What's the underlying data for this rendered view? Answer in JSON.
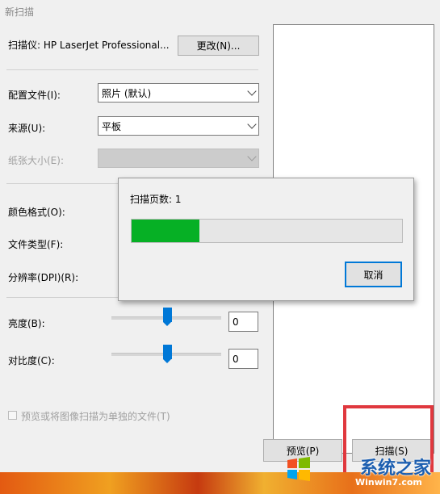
{
  "window": {
    "title": "新扫描"
  },
  "scanner": {
    "label": "扫描仪: HP LaserJet Professional...",
    "change_button": "更改(N)..."
  },
  "profile": {
    "label": "配置文件(I):",
    "value": "照片 (默认)"
  },
  "source": {
    "label": "来源(U):",
    "value": "平板"
  },
  "paper_size": {
    "label": "纸张大小(E):",
    "value": ""
  },
  "color_format": {
    "label": "颜色格式(O):"
  },
  "file_type": {
    "label": "文件类型(F):"
  },
  "resolution": {
    "label": "分辨率(DPI)(R):"
  },
  "brightness": {
    "label": "亮度(B):",
    "value": "0",
    "slider_fraction": 0.5
  },
  "contrast": {
    "label": "对比度(C):",
    "value": "0",
    "slider_fraction": 0.5
  },
  "separate_files": {
    "label": "预览或将图像扫描为单独的文件(T)",
    "checked": false
  },
  "buttons": {
    "preview": "预览(P)",
    "scan": "扫描(S)"
  },
  "progress_dialog": {
    "pages_label": "扫描页数: 1",
    "progress_fraction": 0.25,
    "cancel_button": "取消",
    "progress_color": "#06b025"
  },
  "colors": {
    "accent": "#0078d7",
    "highlight": "#e0383e"
  },
  "watermark": {
    "brand": "系统之家",
    "url": "Winwin7.com"
  }
}
